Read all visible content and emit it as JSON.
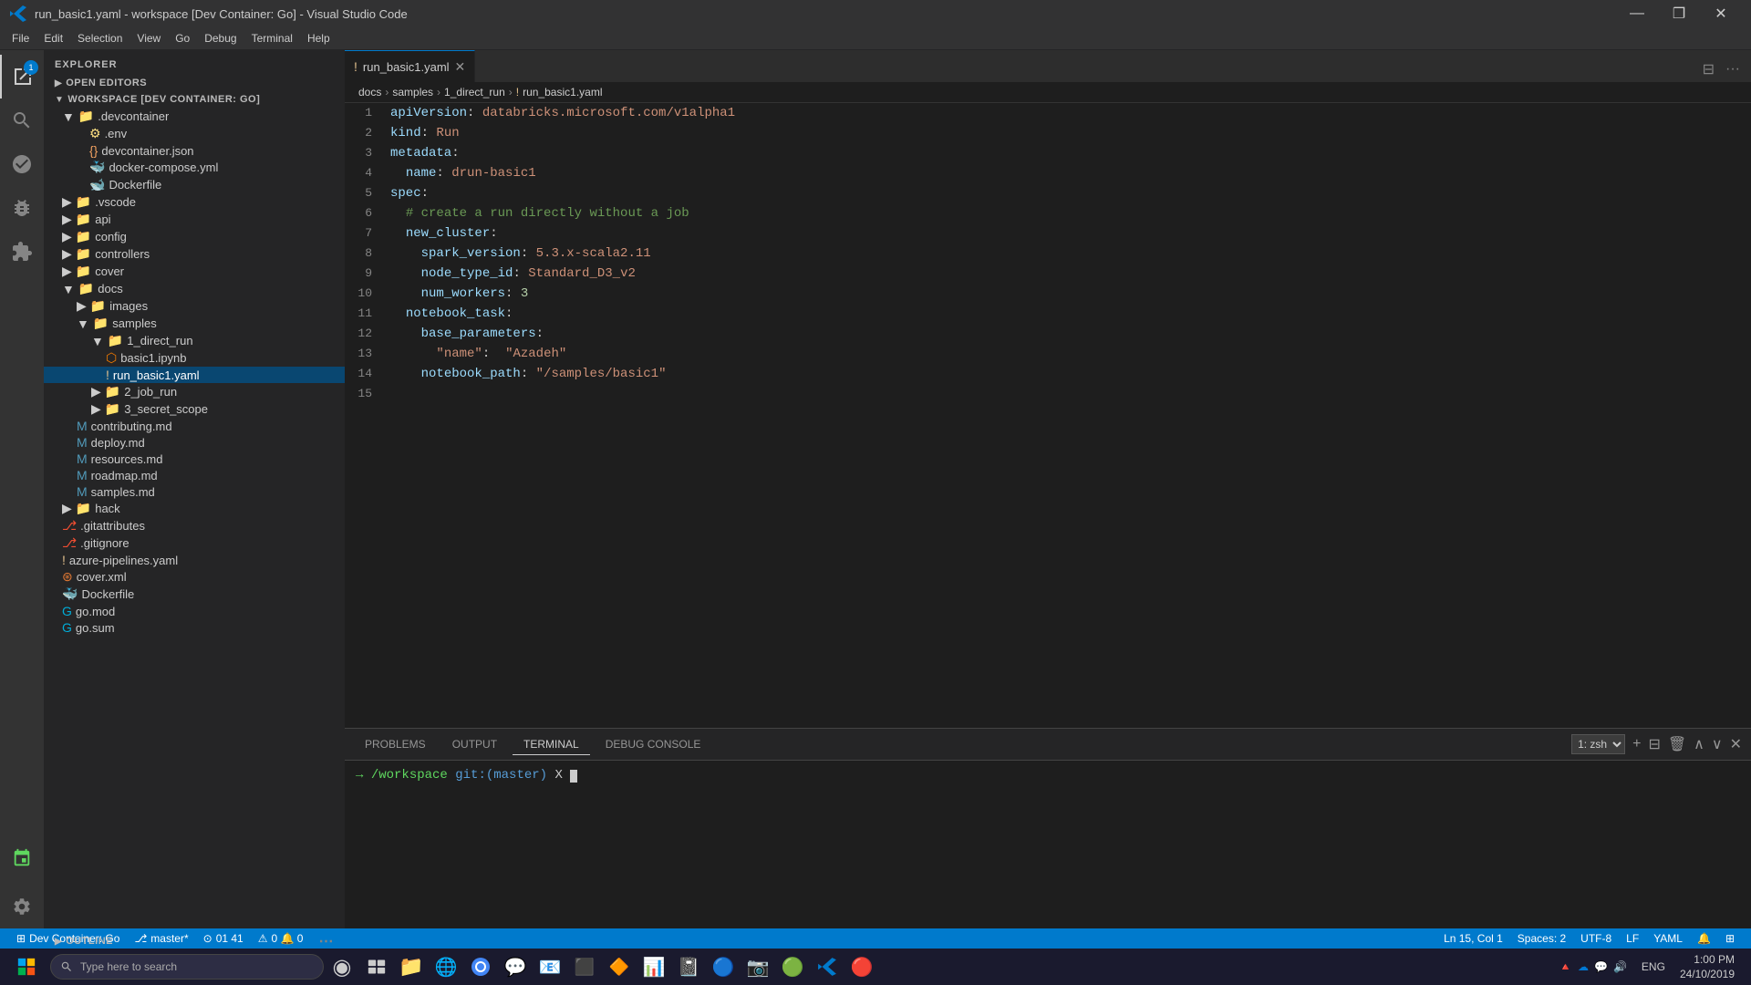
{
  "titlebar": {
    "title": "run_basic1.yaml - workspace [Dev Container: Go] - Visual Studio Code",
    "controls": [
      "—",
      "❐",
      "✕"
    ]
  },
  "menubar": {
    "items": [
      "File",
      "Edit",
      "Selection",
      "View",
      "Go",
      "Debug",
      "Terminal",
      "Help"
    ]
  },
  "activity_bar": {
    "icons": [
      {
        "name": "explorer",
        "symbol": "⎘",
        "active": true,
        "badge": "1"
      },
      {
        "name": "search",
        "symbol": "🔍",
        "active": false
      },
      {
        "name": "source-control",
        "symbol": "⎇",
        "active": false
      },
      {
        "name": "debug",
        "symbol": "▷",
        "active": false
      },
      {
        "name": "extensions",
        "symbol": "⊞",
        "active": false
      }
    ],
    "bottom_icons": [
      {
        "name": "remote",
        "symbol": "⊞"
      },
      {
        "name": "settings",
        "symbol": "⚙"
      }
    ]
  },
  "sidebar": {
    "title": "EXPLORER",
    "sections": {
      "open_editors": "OPEN EDITORS",
      "workspace": "WORKSPACE [DEV CONTAINER: GO]"
    },
    "tree": [
      {
        "label": ".devcontainer",
        "indent": 1,
        "type": "folder",
        "expanded": true
      },
      {
        "label": ".env",
        "indent": 2,
        "type": "env"
      },
      {
        "label": "devcontainer.json",
        "indent": 2,
        "type": "json"
      },
      {
        "label": "docker-compose.yml",
        "indent": 2,
        "type": "docker"
      },
      {
        "label": "Dockerfile",
        "indent": 2,
        "type": "docker"
      },
      {
        "label": ".vscode",
        "indent": 1,
        "type": "folder",
        "expanded": false
      },
      {
        "label": "api",
        "indent": 1,
        "type": "folder",
        "expanded": false
      },
      {
        "label": "config",
        "indent": 1,
        "type": "folder",
        "expanded": false
      },
      {
        "label": "controllers",
        "indent": 1,
        "type": "folder",
        "expanded": false
      },
      {
        "label": "cover",
        "indent": 1,
        "type": "folder",
        "expanded": false
      },
      {
        "label": "docs",
        "indent": 1,
        "type": "folder",
        "expanded": true
      },
      {
        "label": "images",
        "indent": 2,
        "type": "folder",
        "expanded": false
      },
      {
        "label": "samples",
        "indent": 2,
        "type": "folder",
        "expanded": true
      },
      {
        "label": "1_direct_run",
        "indent": 3,
        "type": "folder",
        "expanded": true
      },
      {
        "label": "basic1.ipynb",
        "indent": 4,
        "type": "ipynb"
      },
      {
        "label": "run_basic1.yaml",
        "indent": 4,
        "type": "yaml",
        "selected": true
      },
      {
        "label": "2_job_run",
        "indent": 3,
        "type": "folder",
        "expanded": false
      },
      {
        "label": "3_secret_scope",
        "indent": 3,
        "type": "folder",
        "expanded": false
      },
      {
        "label": "contributing.md",
        "indent": 2,
        "type": "md"
      },
      {
        "label": "deploy.md",
        "indent": 2,
        "type": "md"
      },
      {
        "label": "resources.md",
        "indent": 2,
        "type": "md"
      },
      {
        "label": "roadmap.md",
        "indent": 2,
        "type": "md"
      },
      {
        "label": "samples.md",
        "indent": 2,
        "type": "md"
      },
      {
        "label": "hack",
        "indent": 1,
        "type": "folder",
        "expanded": false
      },
      {
        "label": ".gitattributes",
        "indent": 1,
        "type": "git"
      },
      {
        "label": ".gitignore",
        "indent": 1,
        "type": "git"
      },
      {
        "label": "azure-pipelines.yaml",
        "indent": 1,
        "type": "yaml2"
      },
      {
        "label": "cover.xml",
        "indent": 1,
        "type": "xml"
      },
      {
        "label": "Dockerfile",
        "indent": 1,
        "type": "docker"
      },
      {
        "label": "go.mod",
        "indent": 1,
        "type": "go"
      },
      {
        "label": "go.sum",
        "indent": 1,
        "type": "go"
      }
    ],
    "outline_section": "OUTLINE"
  },
  "editor": {
    "tab": {
      "filename": "run_basic1.yaml",
      "modified": false
    },
    "breadcrumb": [
      "docs",
      ">",
      "samples",
      ">",
      "1_direct_run",
      ">",
      "run_basic1.yaml"
    ],
    "lines": [
      {
        "num": 1,
        "content": "apiVersion: databricks.microsoft.com/v1alpha1"
      },
      {
        "num": 2,
        "content": "kind: Run"
      },
      {
        "num": 3,
        "content": "metadata:"
      },
      {
        "num": 4,
        "content": "  name: drun-basic1"
      },
      {
        "num": 5,
        "content": "spec:"
      },
      {
        "num": 6,
        "content": "  # create a run directly without a job"
      },
      {
        "num": 7,
        "content": "  new_cluster:"
      },
      {
        "num": 8,
        "content": "    spark_version: 5.3.x-scala2.11"
      },
      {
        "num": 9,
        "content": "    node_type_id: Standard_D3_v2"
      },
      {
        "num": 10,
        "content": "    num_workers: 3"
      },
      {
        "num": 11,
        "content": "  notebook_task:"
      },
      {
        "num": 12,
        "content": "    base_parameters:"
      },
      {
        "num": 13,
        "content": "      \"name\":  \"Azadeh\""
      },
      {
        "num": 14,
        "content": "    notebook_path: \"/samples/basic1\""
      },
      {
        "num": 15,
        "content": ""
      }
    ]
  },
  "terminal": {
    "tabs": [
      "PROBLEMS",
      "OUTPUT",
      "TERMINAL",
      "DEBUG CONSOLE"
    ],
    "active_tab": "TERMINAL",
    "shell": "1: zsh",
    "prompt": "→",
    "path": "/workspace",
    "git_branch": "(master)",
    "git_indicator": "X",
    "cursor": ""
  },
  "status_bar": {
    "left": [
      {
        "label": "Dev Container: Go",
        "icon": "⊞"
      },
      {
        "label": "master*"
      },
      {
        "label": "⊙ 01 41"
      },
      {
        "label": "⚠ 0  🔔 0"
      }
    ],
    "right": [
      {
        "label": "Ln 15, Col 1"
      },
      {
        "label": "Spaces: 2"
      },
      {
        "label": "UTF-8"
      },
      {
        "label": "LF"
      },
      {
        "label": "YAML"
      },
      {
        "label": "🔔"
      },
      {
        "label": "⊞"
      }
    ]
  },
  "taskbar": {
    "start_icon": "⊞",
    "search_placeholder": "Type here to search",
    "apps": [
      {
        "name": "cortana",
        "symbol": "◉"
      },
      {
        "name": "task-view",
        "symbol": "⧉"
      },
      {
        "name": "explorer",
        "symbol": "📁"
      },
      {
        "name": "edge",
        "symbol": "🌐"
      },
      {
        "name": "chrome",
        "symbol": "⬤"
      },
      {
        "name": "teams",
        "symbol": "💬"
      },
      {
        "name": "outlook",
        "symbol": "📧"
      },
      {
        "name": "terminal",
        "symbol": "⬛"
      },
      {
        "name": "app7",
        "symbol": "🔶"
      },
      {
        "name": "powerpoint",
        "symbol": "📊"
      },
      {
        "name": "onenote",
        "symbol": "📓"
      },
      {
        "name": "app10",
        "symbol": "🔵"
      },
      {
        "name": "photos",
        "symbol": "📷"
      },
      {
        "name": "greenapp",
        "symbol": "🟢"
      },
      {
        "name": "vscode",
        "symbol": "🔷"
      },
      {
        "name": "redapp",
        "symbol": "🔴"
      }
    ],
    "systray": {
      "icons": [
        "🔺",
        "☁",
        "💬",
        "🔊"
      ],
      "network": "ENG",
      "time": "1:00 PM",
      "date": "24/10/2019"
    }
  }
}
